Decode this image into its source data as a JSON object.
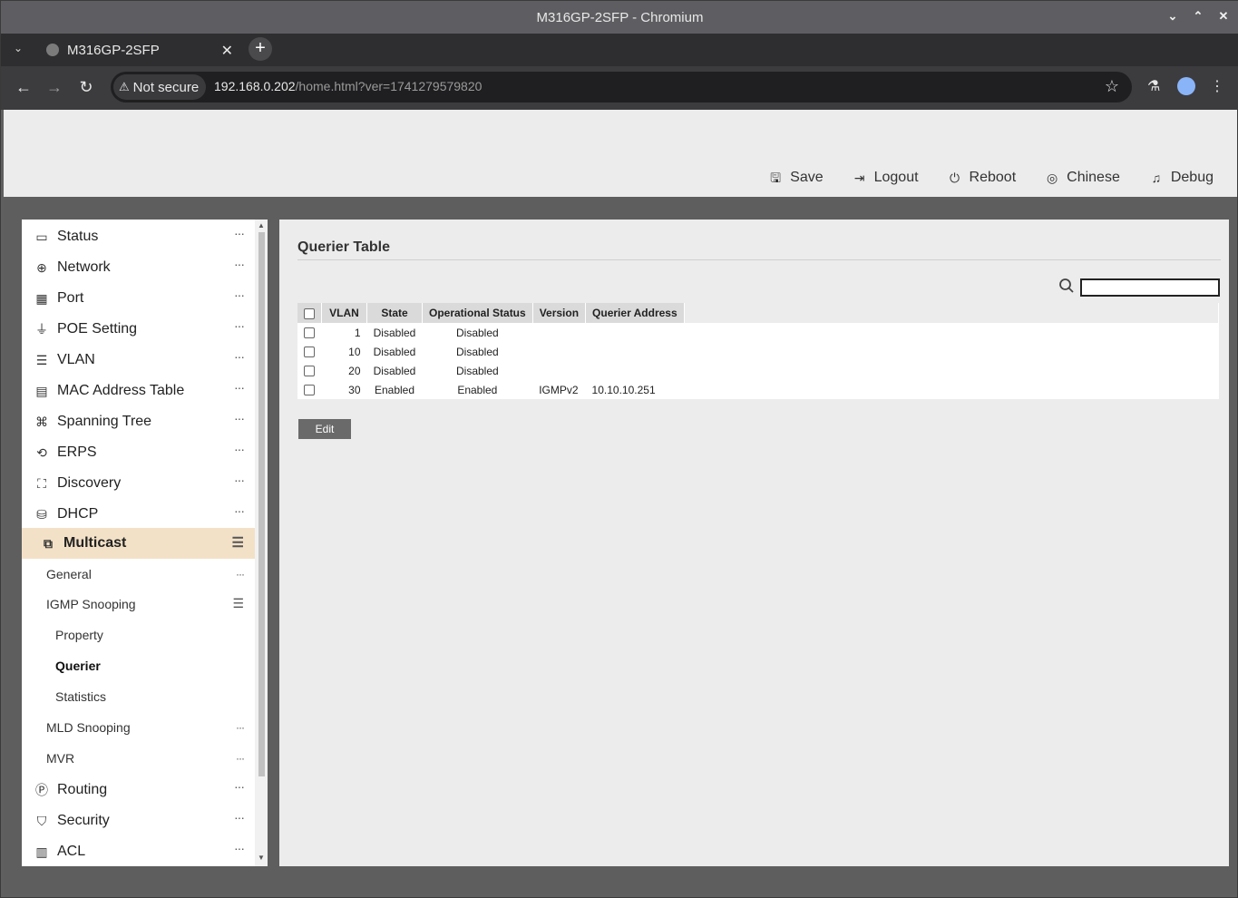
{
  "browser": {
    "window_title": "M316GP-2SFP - Chromium",
    "tab_title": "M316GP-2SFP",
    "security_label": "Not secure",
    "url_host": "192.168.0.202",
    "url_path": "/home.html?ver=1741279579820"
  },
  "header": {
    "actions": [
      {
        "label": "Save",
        "icon": "save-icon"
      },
      {
        "label": "Logout",
        "icon": "logout-icon"
      },
      {
        "label": "Reboot",
        "icon": "power-icon"
      },
      {
        "label": "Chinese",
        "icon": "globe-icon"
      },
      {
        "label": "Debug",
        "icon": "bell-icon"
      }
    ]
  },
  "sidebar": {
    "items": [
      {
        "label": "Status",
        "icon": "monitor-icon"
      },
      {
        "label": "Network",
        "icon": "globe-icon"
      },
      {
        "label": "Port",
        "icon": "network-icon"
      },
      {
        "label": "POE Setting",
        "icon": "plug-icon"
      },
      {
        "label": "VLAN",
        "icon": "list-icon"
      },
      {
        "label": "MAC Address Table",
        "icon": "document-search-icon"
      },
      {
        "label": "Spanning Tree",
        "icon": "tree-icon"
      },
      {
        "label": "ERPS",
        "icon": "ring-icon"
      },
      {
        "label": "Discovery",
        "icon": "topology-icon"
      },
      {
        "label": "DHCP",
        "icon": "database-icon"
      },
      {
        "label": "Multicast",
        "icon": "multicast-icon"
      }
    ],
    "multicast_sub": [
      {
        "label": "General"
      },
      {
        "label": "IGMP Snooping"
      },
      {
        "label": "Property"
      },
      {
        "label": "Querier"
      },
      {
        "label": "Statistics"
      },
      {
        "label": "MLD Snooping"
      },
      {
        "label": "MVR"
      }
    ],
    "bottom_items": [
      {
        "label": "Routing",
        "icon": "ip-icon"
      },
      {
        "label": "Security",
        "icon": "shield-icon"
      },
      {
        "label": "ACL",
        "icon": "acl-icon"
      }
    ]
  },
  "main": {
    "title": "Querier Table",
    "search": {
      "value": "",
      "placeholder": ""
    },
    "table": {
      "columns": [
        "VLAN",
        "State",
        "Operational Status",
        "Version",
        "Querier Address"
      ],
      "rows": [
        {
          "vlan": "1",
          "state": "Disabled",
          "op_status": "Disabled",
          "version": "",
          "querier": ""
        },
        {
          "vlan": "10",
          "state": "Disabled",
          "op_status": "Disabled",
          "version": "",
          "querier": ""
        },
        {
          "vlan": "20",
          "state": "Disabled",
          "op_status": "Disabled",
          "version": "",
          "querier": ""
        },
        {
          "vlan": "30",
          "state": "Enabled",
          "op_status": "Enabled",
          "version": "IGMPv2",
          "querier": "10.10.10.251"
        }
      ]
    },
    "edit_label": "Edit"
  }
}
